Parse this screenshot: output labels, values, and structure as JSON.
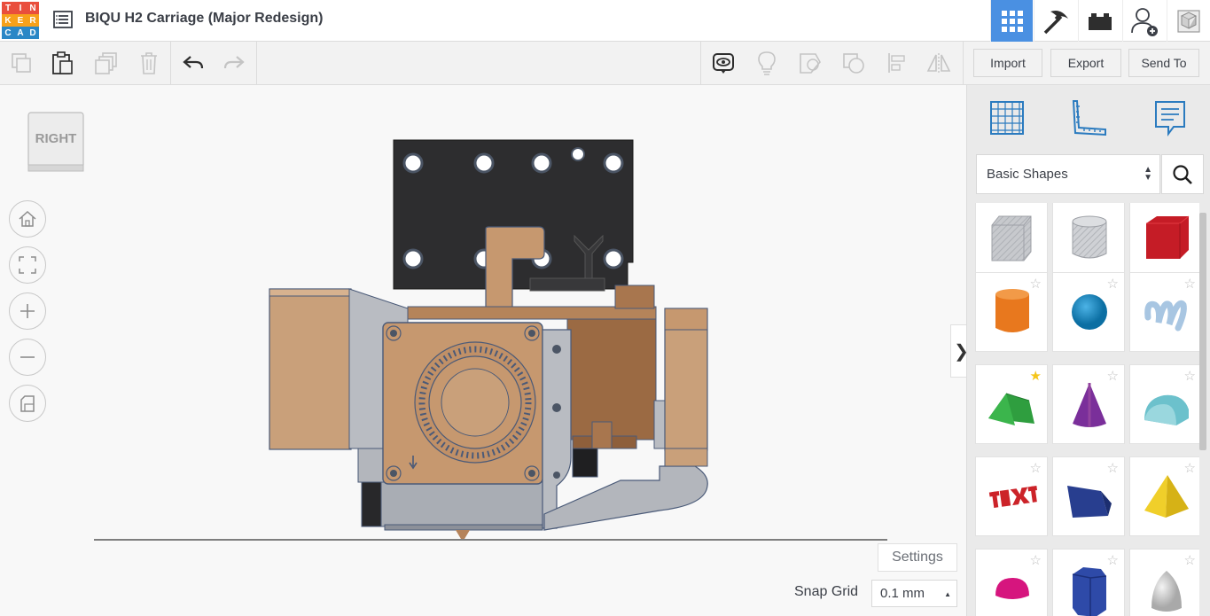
{
  "logo": {
    "letters": [
      "T",
      "I",
      "N",
      "K",
      "E",
      "R",
      "C",
      "A",
      "D"
    ],
    "colors": [
      "#e94e3c",
      "#e94e3c",
      "#e94e3c",
      "#f7a11a",
      "#f7a11a",
      "#f7a11a",
      "#2b87c6",
      "#2b87c6",
      "#2b87c6"
    ]
  },
  "header": {
    "title": "BIQU H2 Carriage (Major Redesign)",
    "icons": [
      "grid-view-icon",
      "pickaxe-icon",
      "bricks-icon",
      "user-add-icon",
      "sim-lab-icon"
    ],
    "active_color": "#4a90e2"
  },
  "toolbar": {
    "edit_icons": [
      "copy-icon",
      "paste-icon",
      "duplicate-icon",
      "delete-icon",
      "undo-icon",
      "redo-icon"
    ],
    "view_icons": [
      "notes-icon",
      "light-bulb-icon",
      "group-icon",
      "ungroup-icon",
      "align-icon",
      "mirror-icon"
    ],
    "import_label": "Import",
    "export_label": "Export",
    "send_to_label": "Send To"
  },
  "workplane": {
    "viewcube_label": "RIGHT",
    "nav": [
      "home-view-icon",
      "fit-view-icon",
      "zoom-in-icon",
      "zoom-out-icon",
      "perspective-icon"
    ],
    "settings_label": "Settings",
    "snap_grid_label": "Snap Grid",
    "snap_grid_value": "0.1 mm",
    "toggle_glyph": "❯"
  },
  "shapes_panel": {
    "top_icons": [
      "workplane-icon",
      "ruler-icon",
      "notes-panel-icon"
    ],
    "library": "Basic Shapes",
    "shapes": [
      {
        "name": "box-hole",
        "color": "#b9bcc2",
        "starred": false
      },
      {
        "name": "cylinder-hole",
        "color": "#b9bcc2",
        "starred": false
      },
      {
        "name": "box",
        "color": "#d3202a",
        "starred": false
      },
      {
        "name": "cylinder",
        "color": "#e8781e",
        "starred": false
      },
      {
        "name": "sphere",
        "color": "#1a8ac4",
        "starred": false
      },
      {
        "name": "scribble",
        "color": "#a8c6e2",
        "starred": false
      },
      {
        "name": "roof",
        "color": "#2f9e3f",
        "starred": true
      },
      {
        "name": "cone",
        "color": "#7a2f9a",
        "starred": false
      },
      {
        "name": "round-roof",
        "color": "#6cc1cc",
        "starred": false
      },
      {
        "name": "text",
        "color": "#cc2329",
        "starred": false
      },
      {
        "name": "wedge",
        "color": "#283e8f",
        "starred": false
      },
      {
        "name": "pyramid",
        "color": "#e7c41e",
        "starred": false
      },
      {
        "name": "half-sphere",
        "color": "#d6157e",
        "starred": false
      },
      {
        "name": "polygon",
        "color": "#2e4aa8",
        "starred": false
      },
      {
        "name": "paraboloid",
        "color": "#c9c9c9",
        "starred": false
      }
    ]
  }
}
